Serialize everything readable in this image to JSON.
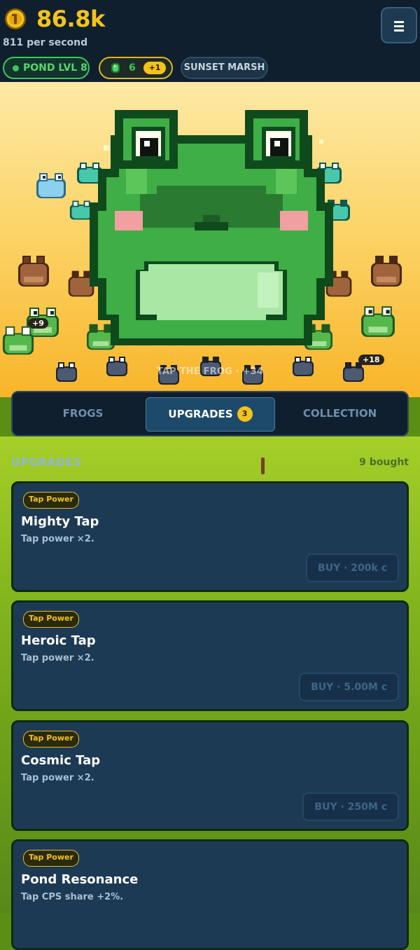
{
  "header": {
    "coins": "86.8k",
    "per_second": "811 per second",
    "pond_level": "POND LVL 8",
    "gems": "6",
    "gem_bonus": "+1",
    "zone": "SUNSET MARSH"
  },
  "game": {
    "tap_hint": "TAP THE FROG · +34",
    "float_badges": [
      "+9",
      "+18"
    ]
  },
  "tabs": [
    {
      "label": "FROGS",
      "active": false
    },
    {
      "label": "UPGRADES",
      "active": true,
      "badge": "3"
    },
    {
      "label": "COLLECTION",
      "active": false
    }
  ],
  "upgrades": {
    "section_title": "UPGRADES",
    "bought": "9 bought",
    "items": [
      {
        "tag": "Tap Power",
        "title": "Mighty Tap",
        "desc": "Tap power ×2.",
        "buy": "BUY · 200k c"
      },
      {
        "tag": "Tap Power",
        "title": "Heroic Tap",
        "desc": "Tap power ×2.",
        "buy": "BUY · 5.00M c"
      },
      {
        "tag": "Tap Power",
        "title": "Cosmic Tap",
        "desc": "Tap power ×2.",
        "buy": "BUY · 250M c"
      },
      {
        "tag": "Tap Power",
        "title": "Pond Resonance",
        "desc": "Tap CPS share +2%.",
        "buy": ""
      }
    ]
  },
  "colors": {
    "coin_gold": "#f5c31c",
    "header_bg": "#0f1f2e",
    "frog_green": "#3fae46",
    "frog_dark": "#0f4a1d",
    "card_bg": "#1d3a55"
  }
}
